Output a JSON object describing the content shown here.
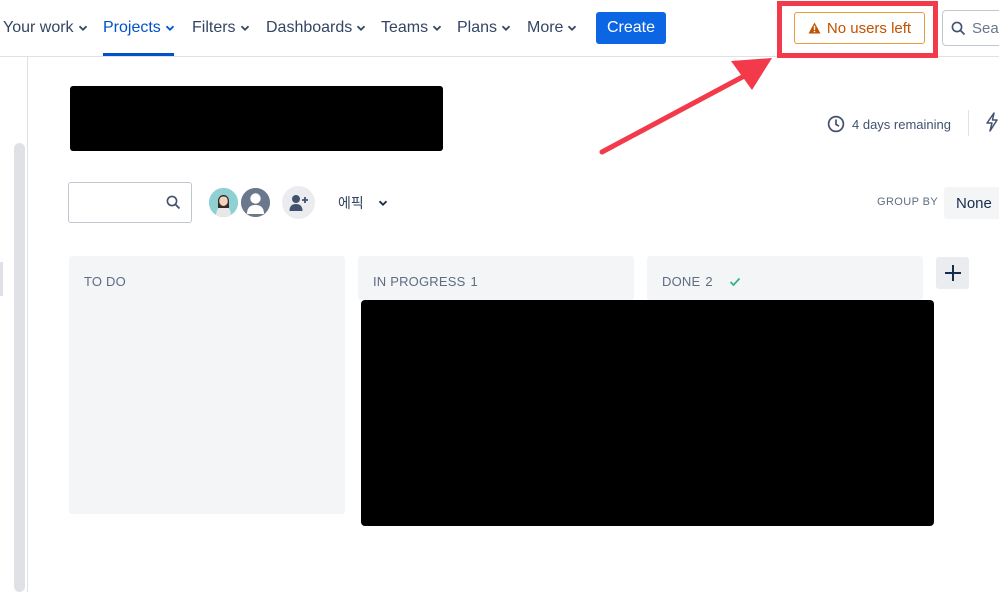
{
  "nav": {
    "items": [
      {
        "label": "Your work",
        "active": false
      },
      {
        "label": "Projects",
        "active": true
      },
      {
        "label": "Filters",
        "active": false
      },
      {
        "label": "Dashboards",
        "active": false
      },
      {
        "label": "Teams",
        "active": false
      },
      {
        "label": "Plans",
        "active": false
      },
      {
        "label": "More",
        "active": false
      }
    ],
    "create_label": "Create",
    "warning_label": "No users left",
    "search_placeholder": "Sea"
  },
  "board": {
    "remaining": "4 days remaining",
    "epic_filter": "에픽",
    "group_by_label": "GROUP BY",
    "group_by_value": "None",
    "columns": [
      {
        "title": "TO DO",
        "count": ""
      },
      {
        "title": "IN PROGRESS",
        "count": "1"
      },
      {
        "title": "DONE",
        "count": "2"
      }
    ]
  },
  "colors": {
    "accent": "#0052cc",
    "create_bg": "#0c66e4",
    "warning_text": "#c25100",
    "annotation": "#f23a4b",
    "column_bg": "#f4f5f7"
  },
  "icons": [
    "chevron-down-icon",
    "warning-icon",
    "search-icon",
    "clock-icon",
    "bolt-icon",
    "user-avatar-icon",
    "add-person-icon",
    "check-icon",
    "plus-icon"
  ]
}
